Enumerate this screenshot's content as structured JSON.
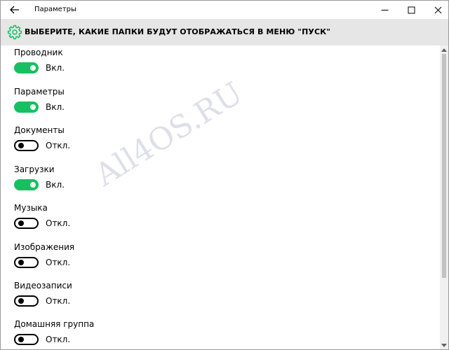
{
  "window": {
    "title": "Параметры"
  },
  "header": {
    "title": "ВЫБЕРИТЕ, КАКИЕ ПАПКИ БУДУТ ОТОБРАЖАТЬСЯ В МЕНЮ \"ПУСК\""
  },
  "icons": {
    "back": "arrow-left-icon",
    "minimize": "minimize-icon",
    "maximize": "maximize-icon",
    "close": "close-icon",
    "settings": "gear-icon"
  },
  "colors": {
    "toggle_on": "#16c060",
    "header_band": "#e6e6e6",
    "gear_accent": "#16c060"
  },
  "settings": [
    {
      "label": "Проводник",
      "on": true,
      "state": "Вкл."
    },
    {
      "label": "Параметры",
      "on": true,
      "state": "Вкл."
    },
    {
      "label": "Документы",
      "on": false,
      "state": "Откл."
    },
    {
      "label": "Загрузки",
      "on": true,
      "state": "Вкл."
    },
    {
      "label": "Музыка",
      "on": false,
      "state": "Откл."
    },
    {
      "label": "Изображения",
      "on": false,
      "state": "Откл."
    },
    {
      "label": "Видеозаписи",
      "on": false,
      "state": "Откл."
    },
    {
      "label": "Домашняя группа",
      "on": false,
      "state": "Откл."
    }
  ],
  "watermark": "All4OS.RU"
}
